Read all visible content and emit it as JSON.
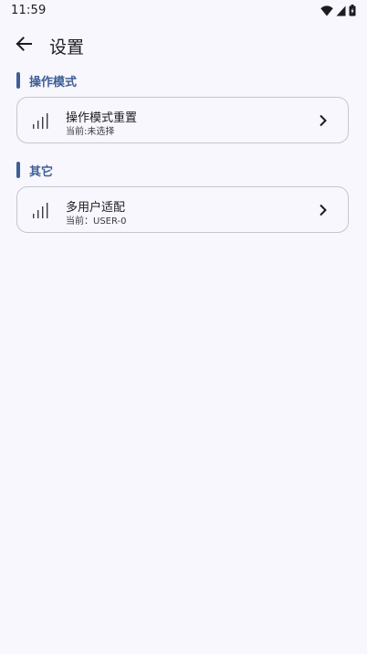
{
  "status_bar": {
    "time": "11:59",
    "icons": [
      "wifi-icon",
      "cellular-signal-icon",
      "battery-icon"
    ]
  },
  "app_bar": {
    "back_icon": "arrow-left-icon",
    "title": "设置"
  },
  "sections": [
    {
      "label": "操作模式",
      "items": [
        {
          "icon": "signal-bars-icon",
          "title": "操作模式重置",
          "subtitle": "当前:未选择",
          "chevron": "chevron-right-icon"
        }
      ]
    },
    {
      "label": "其它",
      "items": [
        {
          "icon": "signal-bars-icon",
          "title": "多用户适配",
          "subtitle": "当前：USER-0",
          "chevron": "chevron-right-icon"
        }
      ]
    }
  ],
  "colors": {
    "background": "#f8f7fd",
    "accent": "#3e5f96",
    "card_border": "#c6c6ce",
    "text_primary": "#1c1b1f"
  }
}
